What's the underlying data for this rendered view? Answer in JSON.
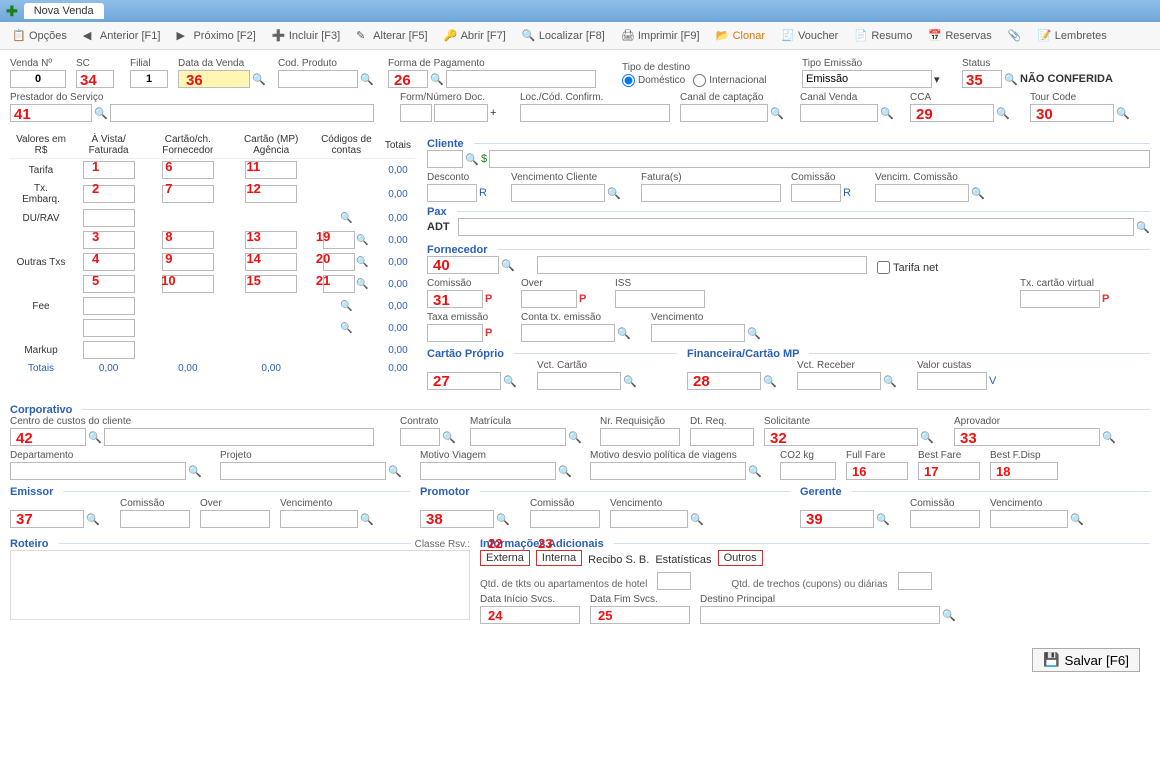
{
  "tab_title": "Nova Venda",
  "toolbar": {
    "opcoes": "Opções",
    "anterior": "Anterior [F1]",
    "proximo": "Próximo [F2]",
    "incluir": "Incluir [F3]",
    "alterar": "Alterar [F5]",
    "abrir": "Abrir [F7]",
    "localizar": "Localizar [F8]",
    "imprimir": "Imprimir [F9]",
    "clonar": "Clonar",
    "voucher": "Voucher",
    "resumo": "Resumo",
    "reservas": "Reservas",
    "lembretes": "Lembretes"
  },
  "top": {
    "venda_no": {
      "label": "Venda Nº",
      "value": "0"
    },
    "sc": {
      "label": "SC",
      "num": "34"
    },
    "filial": {
      "label": "Filial",
      "value": "1"
    },
    "data_venda": {
      "label": "Data da Venda",
      "num": "36"
    },
    "cod_produto": {
      "label": "Cod. Produto"
    },
    "forma_pag": {
      "label": "Forma de Pagamento",
      "num": "26"
    },
    "tipo_destino": {
      "label": "Tipo de destino",
      "domestico": "Doméstico",
      "internacional": "Internacional"
    },
    "tipo_emissao": {
      "label": "Tipo Emissão",
      "value": "Emissão"
    },
    "status": {
      "label": "Status",
      "num": "35",
      "text": "NÃO CONFERIDA"
    },
    "prestador": {
      "label": "Prestador do Serviço",
      "num": "41"
    },
    "form_num": {
      "label": "Form/Número Doc."
    },
    "loc_cod": {
      "label": "Loc./Cód. Confirm."
    },
    "canal_cap": {
      "label": "Canal de captação"
    },
    "canal_venda": {
      "label": "Canal Venda"
    },
    "cca": {
      "label": "CCA",
      "num": "29"
    },
    "tour_code": {
      "label": "Tour Code",
      "num": "30"
    }
  },
  "grid": {
    "h1": "Valores em R$",
    "h2": "À Vista/ Faturada",
    "h3": "Cartão/ch. Fornecedor",
    "h4": "Cartão (MP) Agência",
    "h5": "Códigos de contas",
    "h6": "Totais",
    "rows": {
      "tarifa": "Tarifa",
      "taxe": "Tx. Embarq.",
      "durav": "DU/RAV",
      "outras": "Outras Txs",
      "fee": "Fee",
      "markup": "Markup",
      "totais": "Totais"
    },
    "zeros": "0,00"
  },
  "nums": {
    "n1": "1",
    "n2": "2",
    "n3": "3",
    "n4": "4",
    "n5": "5",
    "n6": "6",
    "n7": "7",
    "n8": "8",
    "n9": "9",
    "n10": "10",
    "n11": "11",
    "n12": "12",
    "n13": "13",
    "n14": "14",
    "n15": "15",
    "n16": "16",
    "n17": "17",
    "n18": "18",
    "n19": "19",
    "n20": "20",
    "n21": "21",
    "n22": "22",
    "n23": "23",
    "n24": "24",
    "n25": "25",
    "n27": "27",
    "n28": "28",
    "n31": "31",
    "n32": "32",
    "n33": "33",
    "n37": "37",
    "n38": "38",
    "n39": "39",
    "n40": "40",
    "n42": "42"
  },
  "cliente": {
    "title": "Cliente",
    "desconto": "Desconto",
    "venc_cliente": "Vencimento Cliente",
    "faturas": "Fatura(s)",
    "comissao": "Comissão",
    "venc_com": "Vencim. Comissão",
    "r": "R",
    "pax_title": "Pax",
    "pax_value": "ADT"
  },
  "fornecedor": {
    "title": "Fornecedor",
    "tarifa_net": "Tarifa net",
    "comissao": "Comissão",
    "over": "Over",
    "iss": "ISS",
    "tx_cartao_virtual": "Tx. cartão virtual",
    "taxa_emissao": "Taxa emissão",
    "conta_tx": "Conta tx. emissão",
    "vencimento": "Vencimento",
    "p": "P"
  },
  "cartao": {
    "title": "Cartão Próprio",
    "vct": "Vct. Cartão"
  },
  "financeira": {
    "title": "Financeira/Cartão MP",
    "vct_receber": "Vct. Receber",
    "valor_custas": "Valor custas",
    "v": "V"
  },
  "corporativo": {
    "title": "Corporativo",
    "centro_custos": "Centro de custos do cliente",
    "contrato": "Contrato",
    "matricula": "Matrícula",
    "nr_req": "Nr. Requisição",
    "dt_req": "Dt. Req.",
    "solicitante": "Solicitante",
    "aprovador": "Aprovador",
    "departamento": "Departamento",
    "projeto": "Projeto",
    "motivo_viagem": "Motivo Viagem",
    "motivo_desvio": "Motivo desvio política de viagens",
    "co2": "CO2 kg",
    "full_fare": "Full Fare",
    "best_fare": "Best Fare",
    "best_fdisp": "Best F.Disp"
  },
  "emissor": {
    "title": "Emissor",
    "comissao": "Comissão",
    "over": "Over",
    "vencimento": "Vencimento"
  },
  "promotor": {
    "title": "Promotor",
    "comissao": "Comissão",
    "vencimento": "Vencimento"
  },
  "gerente": {
    "title": "Gerente",
    "comissao": "Comissão",
    "vencimento": "Vencimento"
  },
  "roteiro": {
    "title": "Roteiro",
    "classe": "Classe Rsv.:"
  },
  "info": {
    "title": "Informações Adicionais",
    "externa": "Externa",
    "interna": "Interna",
    "recibo": "Recibo S. B.",
    "estatisticas": "Estatísticas",
    "outros": "Outros",
    "qtd_tkts": "Qtd. de tkts ou apartamentos de hotel",
    "qtd_trechos": "Qtd. de trechos (cupons) ou diárias",
    "data_inicio": "Data Início Svcs.",
    "data_fim": "Data Fim Svcs.",
    "destino": "Destino Principal"
  },
  "save": "Salvar [F6]"
}
